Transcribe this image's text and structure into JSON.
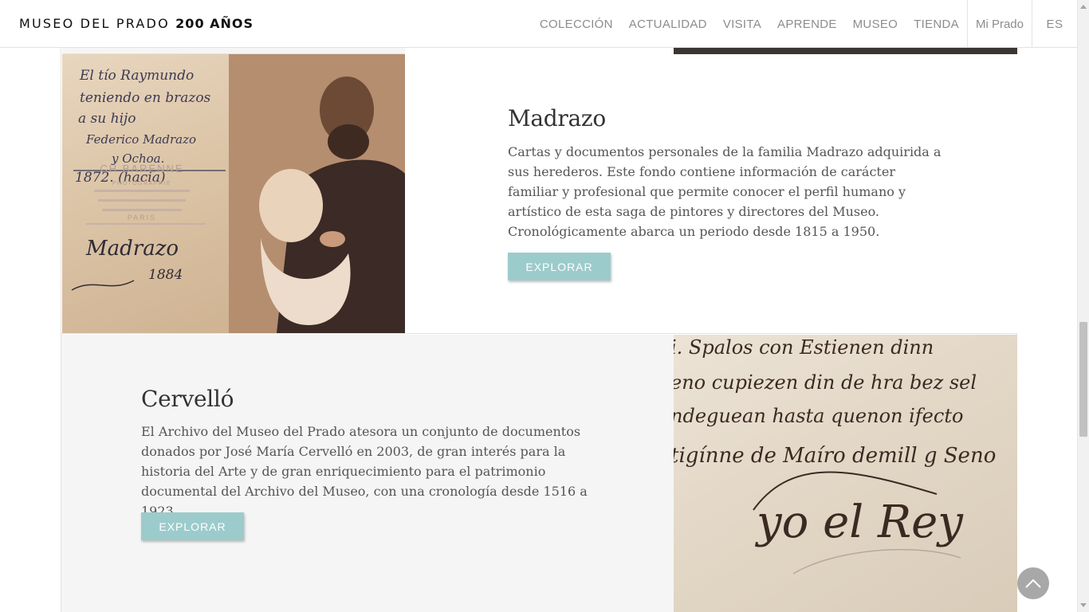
{
  "header": {
    "logo_text": "MUSEO DEL PRADO",
    "logo_bold": "200 AÑOS",
    "nav": [
      "COLECCIÓN",
      "ACTUALIDAD",
      "VISITA",
      "APRENDE",
      "MUSEO",
      "TIENDA"
    ],
    "mi_prado": "Mi Prado",
    "language": "ES"
  },
  "sections": [
    {
      "title": "Madrazo",
      "body": "Cartas y documentos personales de la familia Madrazo adquirida a sus herederos. Este fondo contiene información de carácter familiar y profesional que permite conocer el perfil humano y artístico de esta saga de pintores y directores del Museo. Cronológicamente abarca un periodo desde 1815 a 1950.",
      "button": "EXPLORAR"
    },
    {
      "title": "Cervelló",
      "body": "El Archivo del Museo del Prado atesora un conjunto de documentos donados por José María Cervelló en 2003, de gran interés para la historia del Arte y de gran enriquecimiento para el patrimonio documental del Archivo del Museo, con una cronología desde 1516 a 1923.",
      "button": "EXPLORAR"
    }
  ],
  "letter_image": {
    "lines": [
      "El tío Raymundo",
      "teniendo en brazos",
      "a su hijo",
      "Federico Madrazo",
      "y Ochoa.",
      "1872. (hacia)"
    ],
    "stamp": "CH BARENNE",
    "stamp_sub": "PHOTOGRAPHIE",
    "city": "PARIS",
    "signature": "Madrazo",
    "date": "1884"
  },
  "manuscript_image": {
    "lines": [
      "i. Spalos con  Estienen  dinn",
      "eno cupiezen  din de hra bez sel",
      "ndeguean  hasta quenon ifecto",
      "tigínne de Maíro demill g Seno",
      "yo el Rey"
    ]
  },
  "colors": {
    "button_bg": "#9ccbcc",
    "nav_text": "#8c8c8c",
    "title_text": "#333333",
    "body_text": "#555555"
  }
}
